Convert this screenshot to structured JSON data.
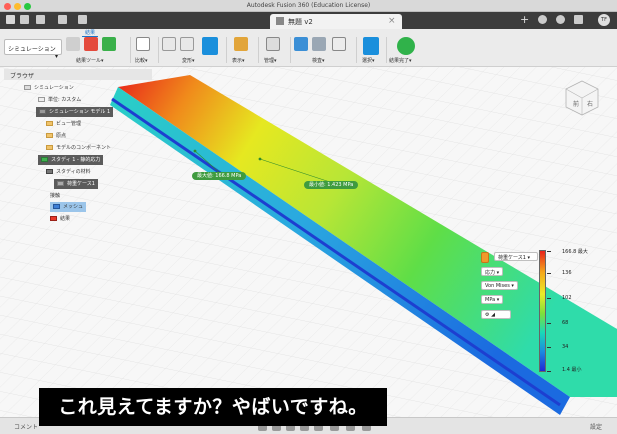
{
  "app": {
    "title": "Autodesk Fusion 360 (Education License)"
  },
  "tab": {
    "label": "無題 v2",
    "close": "×",
    "add": "+"
  },
  "user": {
    "initials": "TF"
  },
  "ribbon": {
    "workspace": "シミュレーション",
    "active_tab": "結果",
    "groups": [
      {
        "label": "結果ツール",
        "arrow": "▾"
      },
      {
        "label": "比較",
        "arrow": "▾"
      },
      {
        "label": "変形",
        "arrow": "▾"
      },
      {
        "label": "表示",
        "arrow": "▾"
      },
      {
        "label": "管理",
        "arrow": "▾"
      },
      {
        "label": "検査",
        "arrow": "▾"
      },
      {
        "label": "選択",
        "arrow": "▾"
      },
      {
        "label": "結果完了",
        "arrow": "▾"
      }
    ]
  },
  "browser": {
    "title": "ブラウザ",
    "items": [
      {
        "label": "シミュレーション"
      },
      {
        "label": "単位: カスタム"
      },
      {
        "label": "シミュレーション モデル 1"
      },
      {
        "label": "ビュー管理"
      },
      {
        "label": "原点"
      },
      {
        "label": "モデルのコンポーネント"
      },
      {
        "label": "スタディ 1 - 静的応力"
      },
      {
        "label": "スタディの材料"
      },
      {
        "label": "荷重ケース1"
      },
      {
        "label": "接触"
      },
      {
        "label": "メッシュ"
      },
      {
        "label": "結果"
      }
    ]
  },
  "probes": {
    "max": "最大値: 166.8 MPa",
    "min": "最小値: 1.423 MPa"
  },
  "results": {
    "load_case": "荷重ケース1",
    "type": "応力",
    "criterion": "Von Mises",
    "unit": "MPa",
    "legend_max": "166.8 最大",
    "ticks": [
      "136",
      "102",
      "68",
      "34"
    ],
    "legend_min": "1.4 最小",
    "colors": [
      "#e8231b",
      "#f5a91c",
      "#ecec27",
      "#7ee03a",
      "#19d9b8",
      "#1b8ae0",
      "#2026d6"
    ]
  },
  "viewcube": {
    "front": "前",
    "right": "右"
  },
  "status": {
    "comments": "コメント",
    "settings": "設定"
  },
  "subtitle": "これ見えてますか？やばいですね。"
}
